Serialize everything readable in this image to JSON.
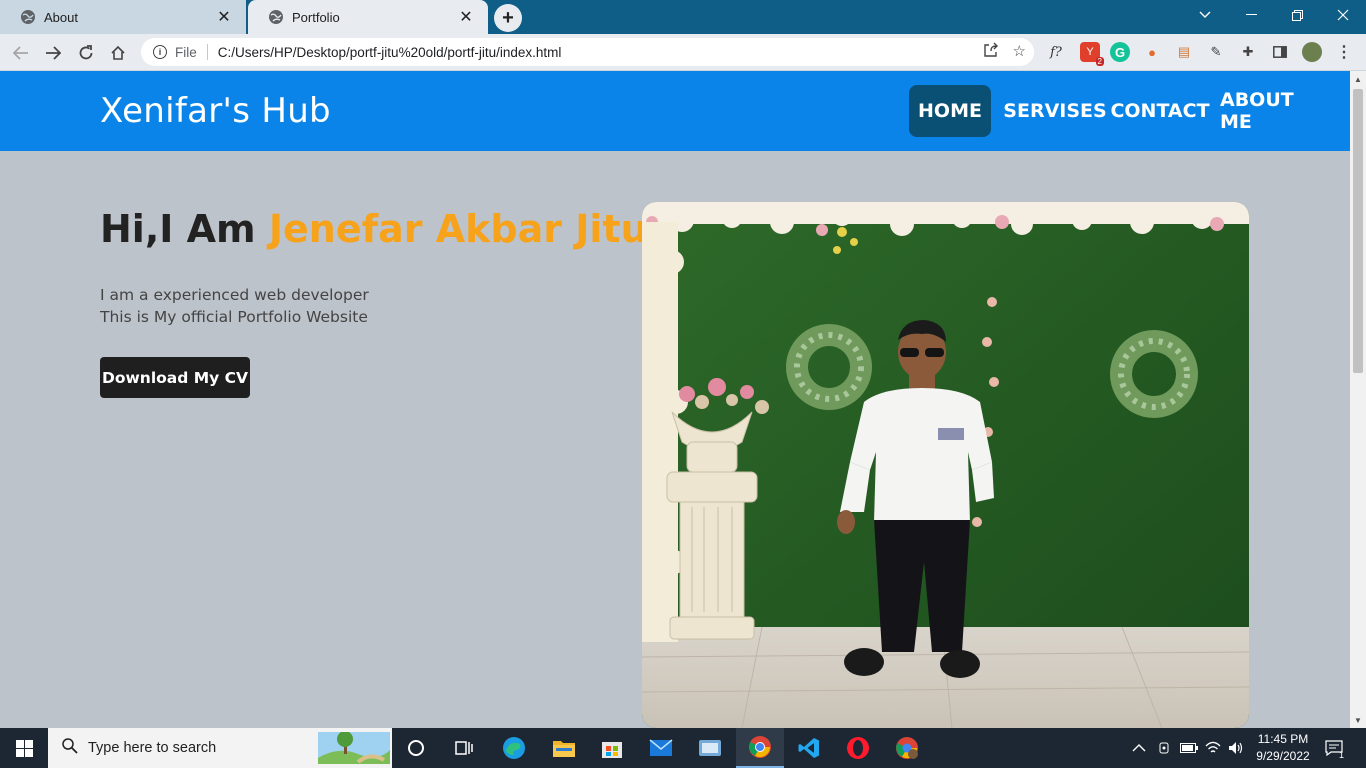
{
  "browser": {
    "tabs": [
      {
        "title": "About",
        "active": false
      },
      {
        "title": "Portfolio",
        "active": true
      }
    ],
    "address": {
      "scheme_label": "File",
      "url": "C:/Users/HP/Desktop/portf-jitu%20old/portf-jitu/index.html"
    },
    "extensions": [
      "f?",
      "2"
    ]
  },
  "site": {
    "brand": "Xenifar's Hub",
    "nav": [
      {
        "label": "HOME",
        "active": true
      },
      {
        "label": "SERVISES",
        "active": false
      },
      {
        "label": "CONTACT",
        "active": false
      },
      {
        "label": "ABOUT ME",
        "active": false
      }
    ],
    "hero": {
      "greeting": "Hi,I Am",
      "name": "Jenefar Akbar Jitu",
      "line1": "I am a experienced web developer",
      "line2": "This is My official Portfolio Website",
      "cv_button": "Download My CV"
    },
    "colors": {
      "navbar": "#0a84e8",
      "nav_active": "#0a4f74",
      "accent_name": "#f7a21b",
      "page_bg": "#bdc3ca"
    }
  },
  "taskbar": {
    "search_placeholder": "Type here to search",
    "time": "11:45 PM",
    "date": "9/29/2022",
    "notification_count": "1"
  }
}
